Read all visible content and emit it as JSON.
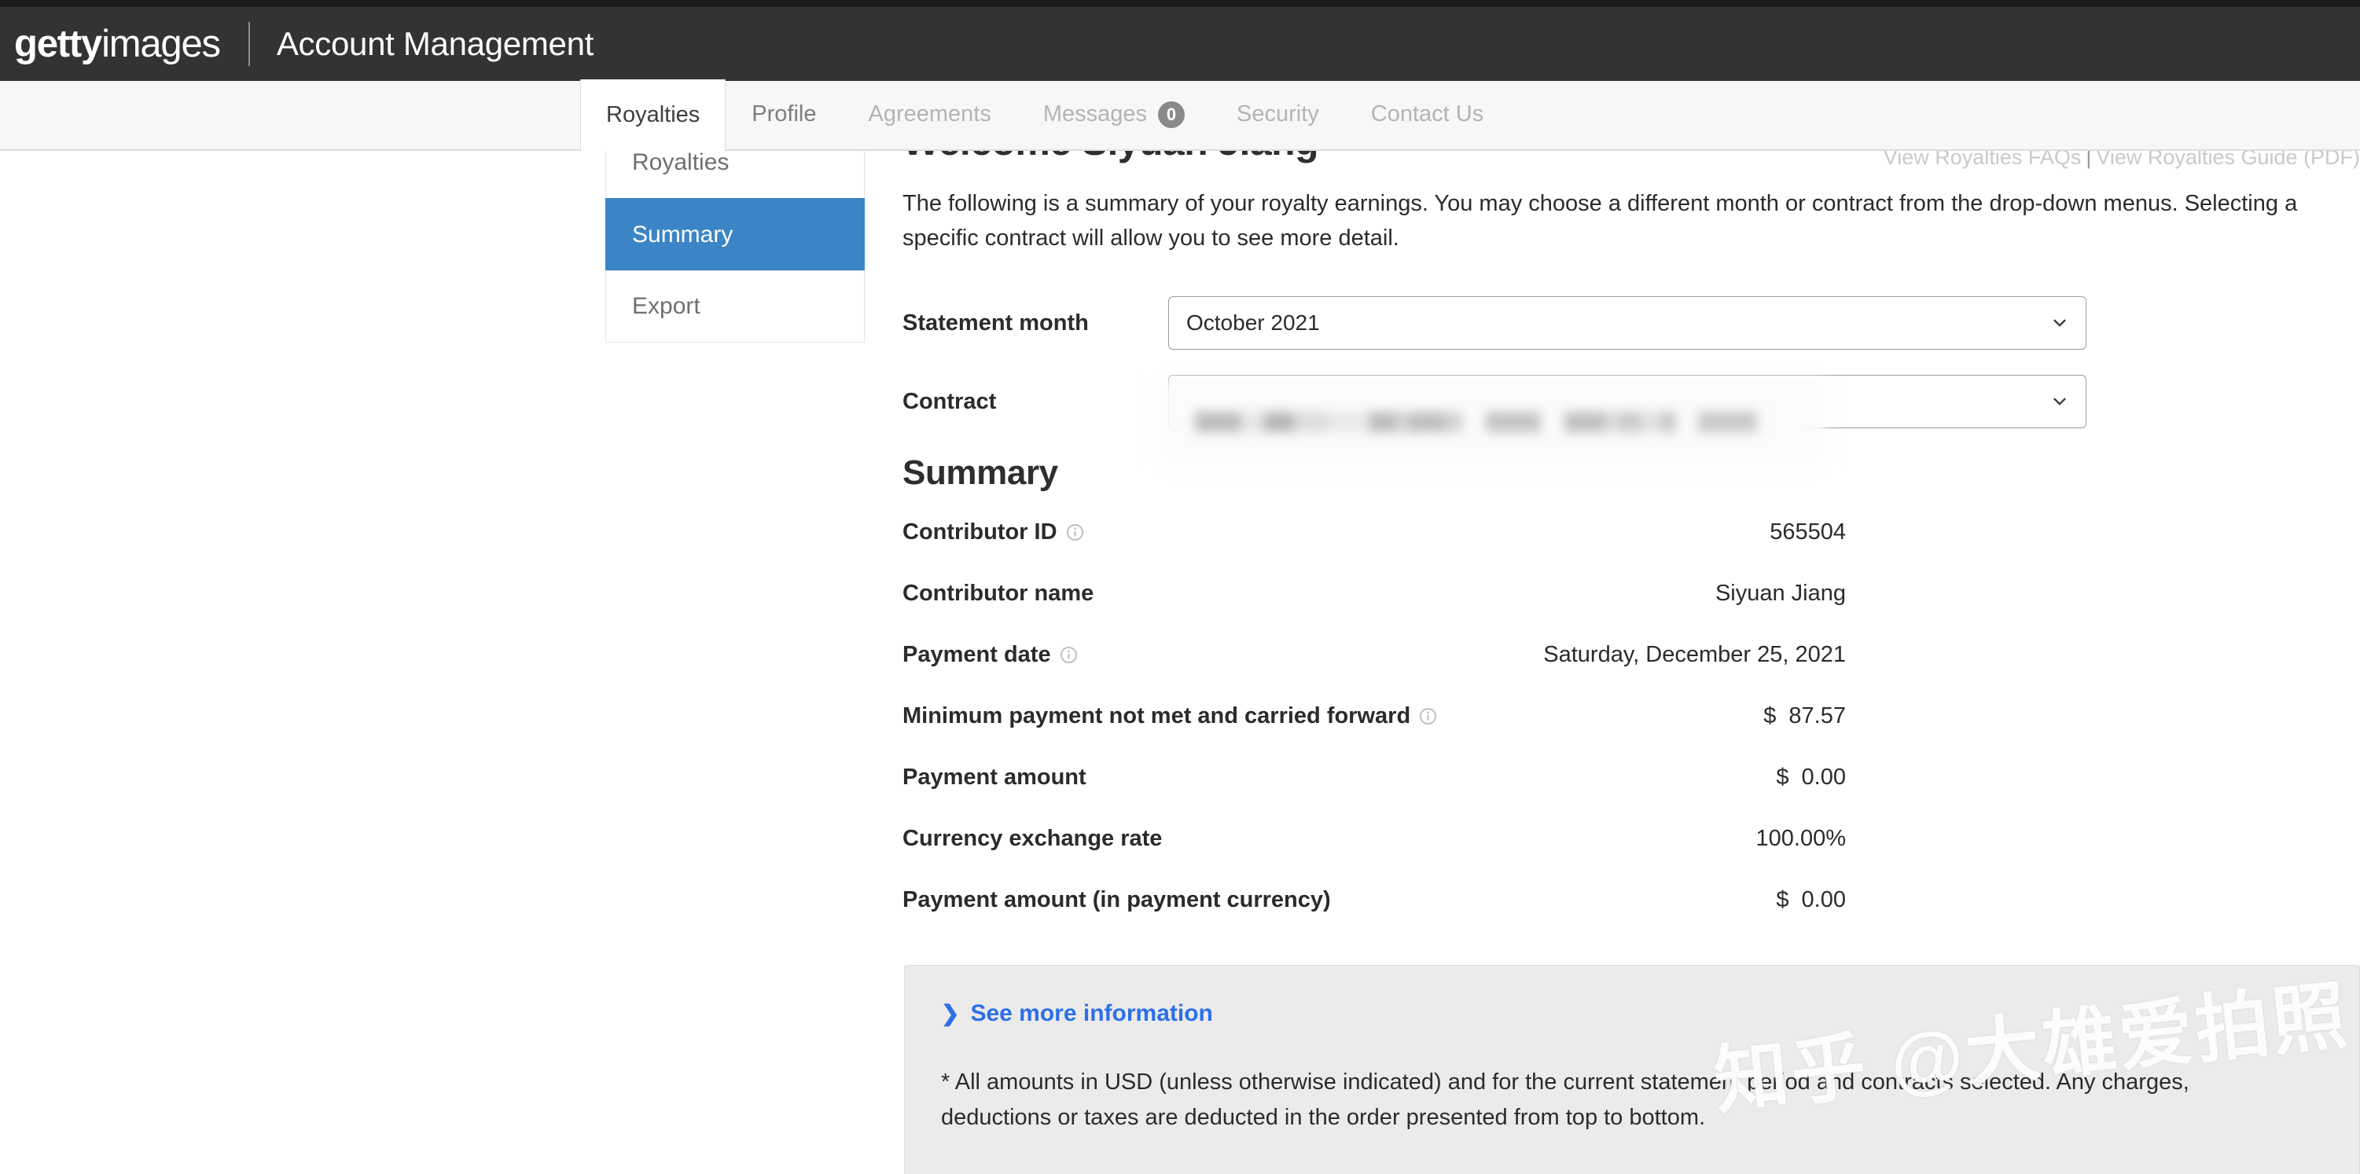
{
  "header": {
    "brand_bold": "getty",
    "brand_light": "images",
    "app_title": "Account Management"
  },
  "tabs": [
    {
      "label": "Royalties",
      "active": true,
      "badge": null
    },
    {
      "label": "Profile",
      "active": false,
      "badge": null
    },
    {
      "label": "Agreements",
      "active": false,
      "badge": null
    },
    {
      "label": "Messages",
      "active": false,
      "badge": "0"
    },
    {
      "label": "Security",
      "active": false,
      "badge": null
    },
    {
      "label": "Contact Us",
      "active": false,
      "badge": null
    }
  ],
  "faq": {
    "faqs_link": "View Royalties FAQs",
    "separator": "|",
    "guide_link": "View Royalties Guide (PDF)"
  },
  "sidebar": {
    "items": [
      {
        "label": "Royalties",
        "active": false
      },
      {
        "label": "Summary",
        "active": true
      },
      {
        "label": "Export",
        "active": false
      }
    ]
  },
  "main": {
    "welcome": "Welcome Siyuan Jiang",
    "intro": "The following is a summary of your royalty earnings. You may choose a different month or contract from the drop-down menus. Selecting a specific contract will allow you to see more detail.",
    "summary_heading": "Summary"
  },
  "form": {
    "statement_month": {
      "label": "Statement month",
      "value": "October 2021"
    },
    "contract": {
      "label": "Contract",
      "value": ""
    }
  },
  "summary_rows": [
    {
      "label": "Contributor ID",
      "info": true,
      "currency": "",
      "value": "565504"
    },
    {
      "label": "Contributor name",
      "info": false,
      "currency": "",
      "value": "Siyuan Jiang"
    },
    {
      "label": "Payment date",
      "info": true,
      "currency": "",
      "value": "Saturday, December 25, 2021"
    },
    {
      "label": "Minimum payment not met and carried forward",
      "info": true,
      "currency": "$",
      "value": "87.57"
    },
    {
      "label": "Payment amount",
      "info": false,
      "currency": "$",
      "value": "0.00"
    },
    {
      "label": "Currency exchange rate",
      "info": false,
      "currency": "",
      "value": "100.00%"
    },
    {
      "label": "Payment amount (in payment currency)",
      "info": false,
      "currency": "$",
      "value": "0.00"
    }
  ],
  "panel": {
    "chevron": "❯",
    "link_label": "See more information",
    "note": "* All amounts in USD (unless otherwise indicated) and for the current statement period and contracts selected. Any charges, deductions or taxes are deducted in the order presented from top to bottom."
  },
  "watermark": {
    "text": "知乎 @大雄爱拍照"
  },
  "colors": {
    "header_bg": "#333333",
    "accent_blue": "#3b85c6",
    "link_blue": "#2d6fe8",
    "panel_bg": "#ebebeb",
    "badge_gray": "#8a8a8a"
  }
}
